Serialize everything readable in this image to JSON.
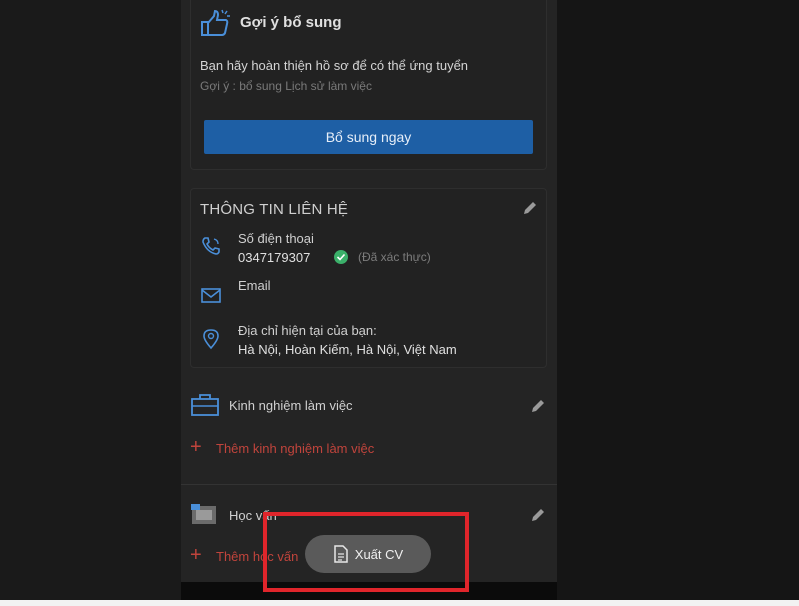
{
  "suggestion": {
    "title": "Gợi ý bổ sung",
    "text": "Bạn hãy hoàn thiện hồ sơ để có thể ứng tuyển",
    "hint": "Gợi ý : bổ sung Lịch sử làm việc",
    "button_label": "Bổ sung ngay"
  },
  "contact": {
    "section_title": "THÔNG TIN LIÊN HỆ",
    "phone_label": "Số điện thoại",
    "phone_value": "0347179307",
    "verified_text": "(Đã xác thực)",
    "email_label": "Email",
    "address_label": "Địa chỉ hiện tại của bạn:",
    "address_value": "Hà Nội, Hoàn Kiếm, Hà Nội, Việt Nam"
  },
  "experience": {
    "title": "Kinh nghiệm làm việc",
    "add_label": "Thêm kinh nghiệm làm việc"
  },
  "education": {
    "title": "Học vấn",
    "add_label": "Thêm học vấn"
  },
  "export": {
    "label": "Xuất CV"
  },
  "colors": {
    "accent_blue": "#1e5fa5",
    "add_red": "#c0443c",
    "verified_green": "#3bb06a",
    "highlight_red": "#e0252b",
    "icon_blue": "#4a8fd9"
  },
  "icons": [
    "thumbs-up-icon",
    "pencil-icon",
    "phone-icon",
    "check-circle-icon",
    "email-icon",
    "location-pin-icon",
    "briefcase-icon",
    "education-card-icon",
    "plus-icon",
    "document-icon"
  ]
}
